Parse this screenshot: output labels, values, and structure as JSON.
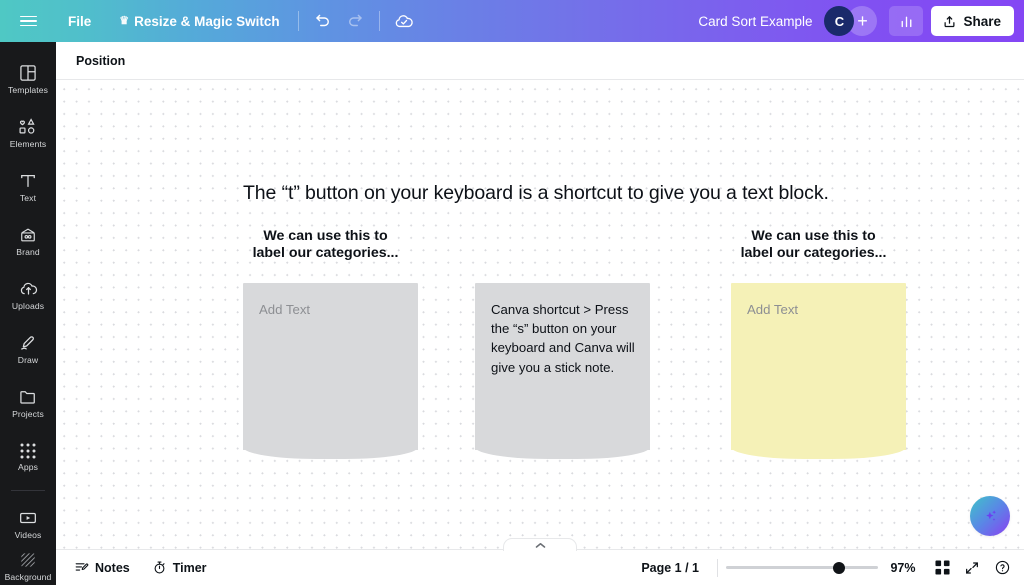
{
  "header": {
    "menu_icon": "hamburger-icon",
    "file_label": "File",
    "resize_label": "Resize & Magic Switch",
    "resize_badge_icon": "crown-icon",
    "undo_icon": "undo-icon",
    "redo_icon": "redo-icon",
    "saved_icon": "cloud-check-icon",
    "doc_title": "Card Sort Example",
    "avatar_initial": "C",
    "add_collaborator_label": "+",
    "insights_icon": "bar-chart-icon",
    "share_label": "Share",
    "share_icon": "upload-icon",
    "gradient_start": "#4fc8c4",
    "gradient_end": "#8446f4"
  },
  "sidebar": {
    "items": [
      {
        "label": "Templates",
        "icon": "templates-icon"
      },
      {
        "label": "Elements",
        "icon": "elements-icon"
      },
      {
        "label": "Text",
        "icon": "text-icon"
      },
      {
        "label": "Brand",
        "icon": "brand-icon"
      },
      {
        "label": "Uploads",
        "icon": "uploads-cloud-icon"
      },
      {
        "label": "Draw",
        "icon": "draw-pen-icon"
      },
      {
        "label": "Projects",
        "icon": "folder-icon"
      },
      {
        "label": "Apps",
        "icon": "apps-grid-icon"
      },
      {
        "label": "Videos",
        "icon": "video-play-icon"
      },
      {
        "label": "Background",
        "icon": "background-hatch-icon"
      }
    ]
  },
  "position_bar": {
    "position_label": "Position"
  },
  "canvas": {
    "title": "The “t” button on your keyboard is a shortcut to give you a text block.",
    "category_label_left": "We can use this to\nlabel our categories...",
    "category_label_right": "We can use this to\nlabel our categories...",
    "stickies": [
      {
        "name": "sticky-note-left",
        "text": "Add Text",
        "is_placeholder": true,
        "color": "#d8d9db"
      },
      {
        "name": "sticky-note-middle",
        "text": "Canva shortcut >\nPress the “s” button on your keyboard and Canva will give you a stick note.",
        "is_placeholder": false,
        "color": "#d8d9db"
      },
      {
        "name": "sticky-note-right",
        "text": "Add Text",
        "is_placeholder": true,
        "color": "#f5f1b7"
      }
    ],
    "magic_button_icon": "sparkle-icon"
  },
  "bottom_bar": {
    "collapse_icon": "chevron-up-icon",
    "notes_label": "Notes",
    "notes_icon": "notes-icon",
    "timer_label": "Timer",
    "timer_icon": "stopwatch-icon",
    "page_indicator": "Page 1 / 1",
    "zoom_value": "97%",
    "zoom_percent": 97,
    "grid_view_icon": "grid-view-icon",
    "fullscreen_icon": "expand-arrows-icon",
    "help_icon": "question-circle-icon"
  }
}
